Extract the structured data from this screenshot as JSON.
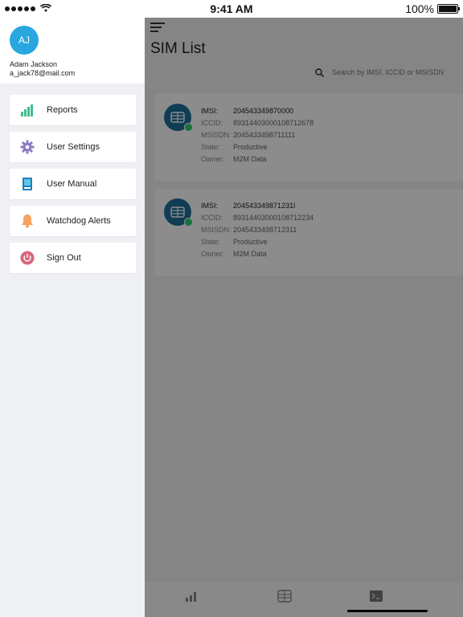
{
  "status_bar": {
    "time": "9:41 AM",
    "battery": "100%"
  },
  "drawer": {
    "user": {
      "initials": "AJ",
      "name": "Adam Jackson",
      "email": "a_jack78@mail.com"
    },
    "menu": [
      {
        "label": "Reports",
        "icon": "bar-chart-icon"
      },
      {
        "label": "User Settings",
        "icon": "gear-icon"
      },
      {
        "label": "User Manual",
        "icon": "book-icon"
      },
      {
        "label": "Watchdog Alerts",
        "icon": "bell-icon"
      },
      {
        "label": "Sign Out",
        "icon": "power-icon"
      }
    ]
  },
  "main": {
    "title": "SIM List",
    "search": {
      "placeholder": "Search by IMSI, ICCID or MSISDN"
    },
    "cards": [
      {
        "fields": [
          {
            "label": "IMSI:",
            "value": "204543349870000"
          },
          {
            "label": "ICCID:",
            "value": "89314403000108712678"
          },
          {
            "label": "MSISDN:",
            "value": "2045433498711111"
          },
          {
            "label": "State:",
            "value": "Productive"
          },
          {
            "label": "Owner:",
            "value": "M2M Data"
          }
        ]
      },
      {
        "fields": [
          {
            "label": "IMSI:",
            "value": "204543349871231l"
          },
          {
            "label": "ICCID:",
            "value": "89314403000108712234"
          },
          {
            "label": "MSISDN:",
            "value": "2045433498712311"
          },
          {
            "label": "State:",
            "value": "Productive"
          },
          {
            "label": "Owner:",
            "value": "M2M Data"
          }
        ]
      }
    ],
    "tabs": [
      {
        "icon": "bar-chart-icon"
      },
      {
        "icon": "sim-card-icon"
      },
      {
        "icon": "terminal-icon"
      }
    ]
  },
  "colors": {
    "accent": "#29a7e0",
    "sim_badge": "#1d6f9a",
    "online": "#2ecc71",
    "drawer_bg": "#eff0f4"
  }
}
